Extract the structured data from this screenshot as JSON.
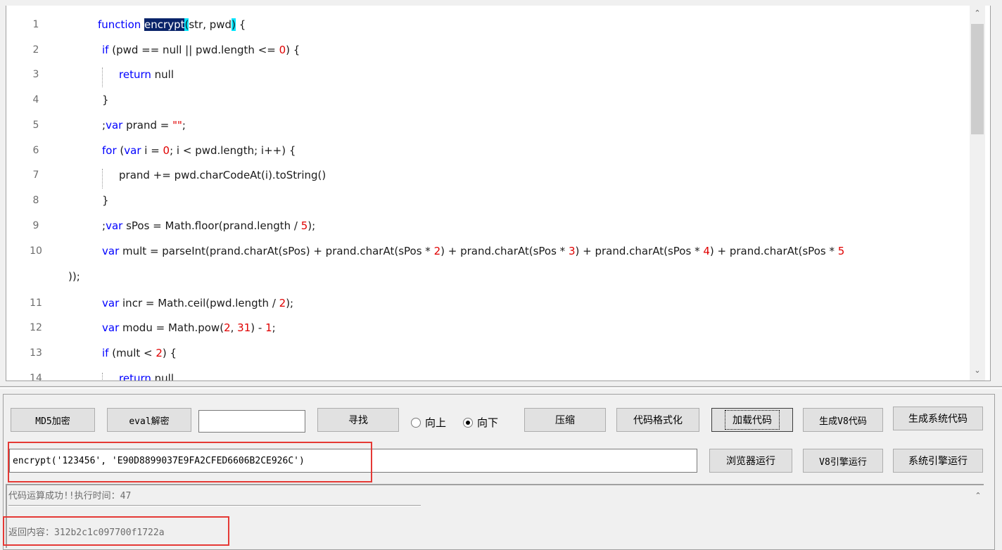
{
  "editor": {
    "lines": [
      {
        "num": "1",
        "parts": [
          [
            "kw",
            "function "
          ],
          [
            "hl",
            "encrypt"
          ],
          [
            "cy",
            "("
          ],
          [
            "t",
            "str, pwd"
          ],
          [
            "cy",
            ")"
          ],
          [
            "t",
            " {"
          ]
        ]
      },
      {
        "num": "2",
        "parts": [
          [
            "kw",
            "if"
          ],
          [
            "t",
            " (pwd == null || pwd.length <= "
          ],
          [
            "num",
            "0"
          ],
          [
            "t",
            ") {"
          ]
        ]
      },
      {
        "num": "3",
        "parts": [
          [
            "kw",
            "return"
          ],
          [
            "t",
            " null"
          ]
        ]
      },
      {
        "num": "4",
        "parts": [
          [
            "t",
            "}"
          ]
        ]
      },
      {
        "num": "5",
        "parts": [
          [
            "t",
            ";"
          ],
          [
            "kw",
            "var"
          ],
          [
            "t",
            " prand = "
          ],
          [
            "str",
            "\"\""
          ],
          [
            "t",
            ";"
          ]
        ]
      },
      {
        "num": "6",
        "parts": [
          [
            "kw",
            "for"
          ],
          [
            "t",
            " ("
          ],
          [
            "kw",
            "var"
          ],
          [
            "t",
            " i = "
          ],
          [
            "num",
            "0"
          ],
          [
            "t",
            "; i < pwd.length; i++) {"
          ]
        ]
      },
      {
        "num": "7",
        "parts": [
          [
            "t",
            "prand += pwd.charCodeAt(i).toString()"
          ]
        ]
      },
      {
        "num": "8",
        "parts": [
          [
            "t",
            "}"
          ]
        ]
      },
      {
        "num": "9",
        "parts": [
          [
            "t",
            ";"
          ],
          [
            "kw",
            "var"
          ],
          [
            "t",
            " sPos = Math.floor(prand.length / "
          ],
          [
            "num",
            "5"
          ],
          [
            "t",
            ");"
          ]
        ]
      },
      {
        "num": "10",
        "parts": [
          [
            "kw",
            "var"
          ],
          [
            "t",
            " mult = parseInt(prand.charAt(sPos) + prand.charAt(sPos * "
          ],
          [
            "num",
            "2"
          ],
          [
            "t",
            ") + prand.charAt(sPos * "
          ],
          [
            "num",
            "3"
          ],
          [
            "t",
            ") + prand.charAt(sPos * "
          ],
          [
            "num",
            "4"
          ],
          [
            "t",
            ") + prand.charAt(sPos * "
          ],
          [
            "num",
            "5"
          ]
        ]
      },
      {
        "num": "",
        "parts": [
          [
            "t",
            "));"
          ]
        ]
      },
      {
        "num": "11",
        "parts": [
          [
            "kw",
            "var"
          ],
          [
            "t",
            " incr = Math.ceil(pwd.length / "
          ],
          [
            "num",
            "2"
          ],
          [
            "t",
            ");"
          ]
        ]
      },
      {
        "num": "12",
        "parts": [
          [
            "kw",
            "var"
          ],
          [
            "t",
            " modu = Math.pow("
          ],
          [
            "num",
            "2"
          ],
          [
            "t",
            ", "
          ],
          [
            "num",
            "31"
          ],
          [
            "t",
            ") - "
          ],
          [
            "num",
            "1"
          ],
          [
            "t",
            ";"
          ]
        ]
      },
      {
        "num": "13",
        "parts": [
          [
            "kw",
            "if"
          ],
          [
            "t",
            " (mult < "
          ],
          [
            "num",
            "2"
          ],
          [
            "t",
            ") {"
          ]
        ]
      },
      {
        "num": "14",
        "parts": [
          [
            "kw",
            "return"
          ],
          [
            "t",
            " null"
          ]
        ]
      }
    ]
  },
  "toolbar": {
    "md5": "MD5加密",
    "eval": "eval解密",
    "search_value": "",
    "find": "寻找",
    "up": "向上",
    "down": "向下",
    "compress": "压缩",
    "format": "代码格式化",
    "load": "加载代码",
    "gen_v8": "生成V8代码",
    "gen_sys": "生成系统代码",
    "browser_run": "浏览器运行",
    "v8_run": "V8引擎运行",
    "sys_run": "系统引擎运行"
  },
  "expression": "encrypt('123456', 'E90D8899037E9FA2CFED6606B2CE926C')",
  "output": {
    "status": "代码运算成功!!执行时间：47",
    "result": "返回内容：312b2c1c097700f1722a"
  }
}
